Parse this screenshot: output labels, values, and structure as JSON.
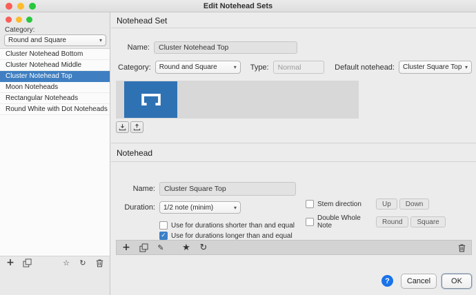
{
  "window": {
    "title": "Edit Notehead Sets"
  },
  "icons": {
    "chevron_down": "▾",
    "plus": "+",
    "star_filled": "★",
    "star_outline": "☆",
    "refresh": "↻",
    "pencil": "✎",
    "check": "✓",
    "help": "?"
  },
  "sidebar": {
    "category_label": "Category:",
    "category_value": "Round and Square",
    "items": [
      {
        "label": "Cluster Notehead Bottom",
        "selected": false
      },
      {
        "label": "Cluster Notehead Middle",
        "selected": false
      },
      {
        "label": "Cluster Notehead Top",
        "selected": true
      },
      {
        "label": "Moon Noteheads",
        "selected": false
      },
      {
        "label": "Rectangular Noteheads",
        "selected": false
      },
      {
        "label": "Round White with Dot Noteheads",
        "selected": false
      }
    ]
  },
  "set_section": {
    "title": "Notehead Set",
    "name_label": "Name:",
    "name_value": "Cluster Notehead Top",
    "category_label": "Category:",
    "category_value": "Round and Square",
    "type_label": "Type:",
    "type_value": "Normal",
    "default_label": "Default notehead:",
    "default_value": "Cluster Square Top"
  },
  "notehead_section": {
    "title": "Notehead",
    "name_label": "Name:",
    "name_value": "Cluster Square Top",
    "duration_label": "Duration:",
    "duration_value": "1/2 note (minim)",
    "shorter": {
      "label": "Use for durations shorter than and equal",
      "checked": false
    },
    "longer": {
      "label": "Use for durations longer than and equal",
      "checked": true
    },
    "stem": {
      "label": "Stem direction",
      "checked": false
    },
    "stem_up": "Up",
    "stem_down": "Down",
    "double_whole": {
      "label": "Double Whole Note",
      "checked": false
    },
    "dw_round": "Round",
    "dw_square": "Square"
  },
  "footer": {
    "cancel": "Cancel",
    "ok": "OK"
  },
  "colors": {
    "accent": "#3a7fc8",
    "selection_blue": "#3f7fc1",
    "preview_tile_blue": "#2e72b4",
    "help_blue": "#1a73e8"
  }
}
